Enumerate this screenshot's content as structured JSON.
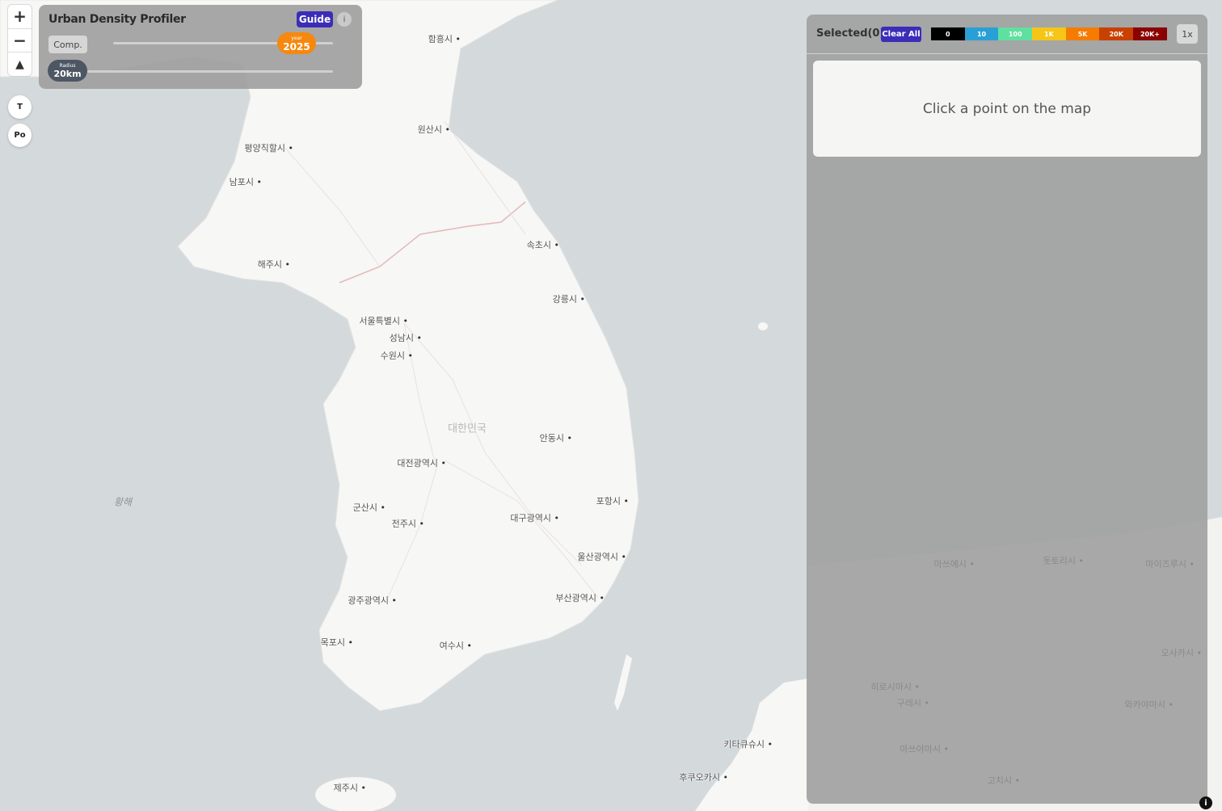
{
  "app": {
    "title": "Urban Density Profiler"
  },
  "controls": {
    "guide_label": "Guide",
    "info_label": "i",
    "comp_label": "Comp.",
    "year_caption": "year",
    "year_value": "2025",
    "radius_caption": "Radius",
    "radius_value": "20km"
  },
  "zoom": {
    "in_label": "+",
    "out_label": "−",
    "compass_label": "▲"
  },
  "toggles": {
    "t_label": "T",
    "po_label": "Po"
  },
  "side_panel": {
    "selected_label": "Selected(0)",
    "clear_label": "Clear All",
    "legend": [
      {
        "label": "0",
        "color": "#000000"
      },
      {
        "label": "10",
        "color": "#2a9fd6"
      },
      {
        "label": "100",
        "color": "#5fe0a0"
      },
      {
        "label": "1K",
        "color": "#f5c518"
      },
      {
        "label": "5K",
        "color": "#f57c00"
      },
      {
        "label": "20K",
        "color": "#c94100"
      },
      {
        "label": "20K+",
        "color": "#8b0000"
      }
    ],
    "speed_label": "1x",
    "placeholder_text": "Click a point on the map"
  },
  "map": {
    "country_label": "대한민국",
    "sea_label": "황해",
    "cities": [
      {
        "name": "함흥시"
      },
      {
        "name": "원산시"
      },
      {
        "name": "평양직할시"
      },
      {
        "name": "남포시"
      },
      {
        "name": "해주시"
      },
      {
        "name": "속초시"
      },
      {
        "name": "강릉시"
      },
      {
        "name": "서울특별시"
      },
      {
        "name": "성남시"
      },
      {
        "name": "수원시"
      },
      {
        "name": "안동시"
      },
      {
        "name": "대전광역시"
      },
      {
        "name": "포항시"
      },
      {
        "name": "군산시"
      },
      {
        "name": "전주시"
      },
      {
        "name": "대구광역시"
      },
      {
        "name": "울산광역시"
      },
      {
        "name": "광주광역시"
      },
      {
        "name": "부산광역시"
      },
      {
        "name": "목포시"
      },
      {
        "name": "여수시"
      },
      {
        "name": "키타큐슈시"
      },
      {
        "name": "후쿠오카시"
      },
      {
        "name": "제주시"
      },
      {
        "name": "마쓰에시"
      },
      {
        "name": "돗토리시"
      },
      {
        "name": "마이즈루시"
      },
      {
        "name": "오사카시"
      },
      {
        "name": "히로시마시"
      },
      {
        "name": "구레시"
      },
      {
        "name": "와카야마시"
      },
      {
        "name": "마쓰야마시"
      },
      {
        "name": "고치시"
      }
    ]
  }
}
